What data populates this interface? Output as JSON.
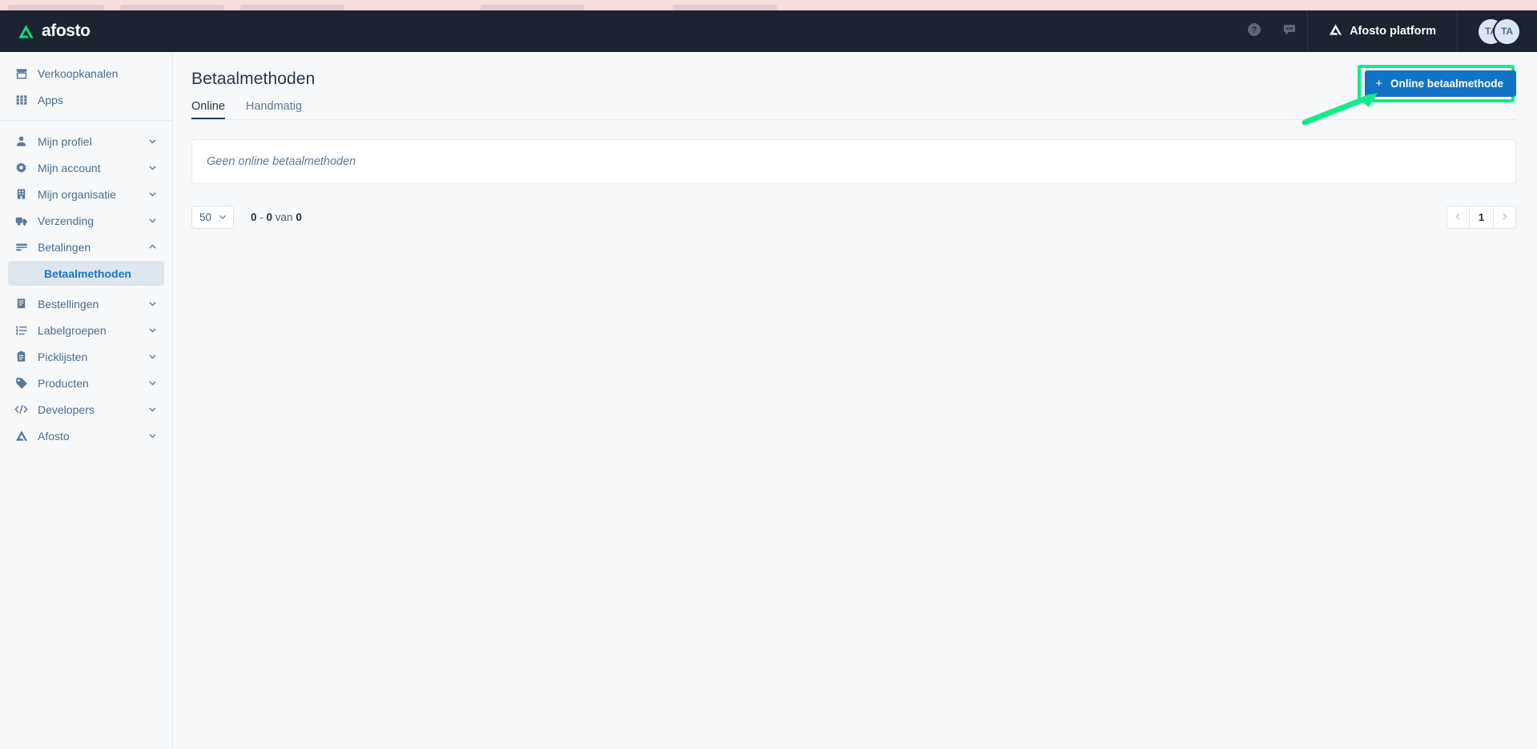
{
  "browser": {
    "strip_color": "#fadcdc"
  },
  "topbar": {
    "brand": "afosto",
    "brand_icon": "afosto-logo-icon",
    "help_icon": "question-circle-icon",
    "chat_icon": "chat-bubble-icon",
    "platform_label": "Afosto platform",
    "platform_icon": "afosto-triangle-icon",
    "avatar_primary": "TA",
    "avatar_secondary": "TA",
    "background": "#1b2430"
  },
  "sidebar": {
    "top_items": [
      {
        "label": "Verkoopkanalen",
        "icon": "storefront-icon"
      },
      {
        "label": "Apps",
        "icon": "grid-apps-icon"
      }
    ],
    "groups": [
      {
        "label": "Mijn profiel",
        "icon": "user-icon",
        "expanded": false
      },
      {
        "label": "Mijn account",
        "icon": "gear-icon",
        "expanded": false
      },
      {
        "label": "Mijn organisatie",
        "icon": "building-icon",
        "expanded": false
      },
      {
        "label": "Verzending",
        "icon": "truck-icon",
        "expanded": false
      },
      {
        "label": "Betalingen",
        "icon": "card-icon",
        "expanded": true
      },
      {
        "label": "Bestellingen",
        "icon": "receipt-icon",
        "expanded": false
      },
      {
        "label": "Labelgroepen",
        "icon": "list-icon",
        "expanded": false
      },
      {
        "label": "Picklijsten",
        "icon": "clipboard-icon",
        "expanded": false
      },
      {
        "label": "Producten",
        "icon": "tag-icon",
        "expanded": false
      },
      {
        "label": "Developers",
        "icon": "code-icon",
        "expanded": false
      },
      {
        "label": "Afosto",
        "icon": "afosto-triangle-icon",
        "expanded": false
      }
    ],
    "sub_item": {
      "label": "Betaalmethoden",
      "active": true,
      "color": "#1877cf"
    }
  },
  "main": {
    "title": "Betaalmethoden",
    "tabs": [
      {
        "label": "Online",
        "active": true
      },
      {
        "label": "Handmatig",
        "active": false
      }
    ],
    "empty_message": "Geen online betaalmethoden",
    "pagination": {
      "page_size": "50",
      "count_from": "0",
      "count_to": "0",
      "count_separator": "van",
      "count_total": "0",
      "prev_icon": "chevron-left-icon",
      "next_icon": "chevron-right-icon",
      "current_page": "1"
    },
    "primary_button": {
      "label": "Online betaalmethode",
      "plus": "+",
      "color": "#1273c4"
    }
  },
  "annotation": {
    "highlight_color": "#12eb8a",
    "arrow_icon": "arrow-pointer-icon"
  }
}
